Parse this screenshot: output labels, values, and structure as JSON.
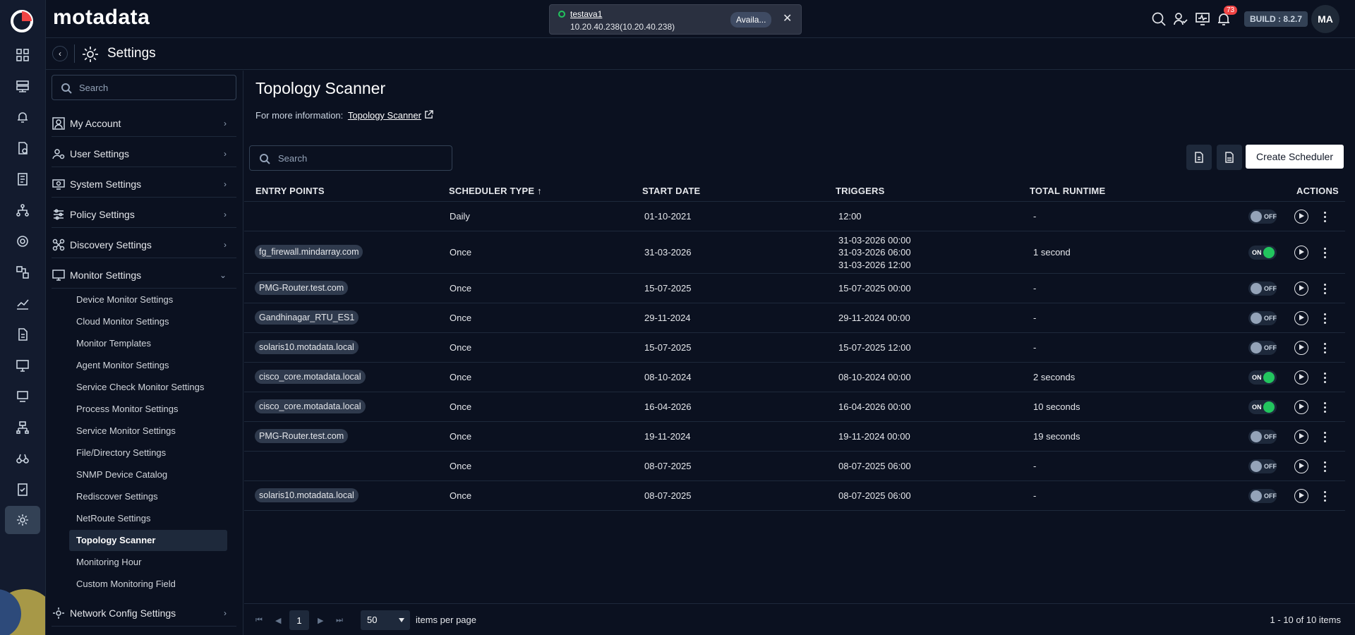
{
  "app": {
    "brand": "motadata",
    "page_title": "Settings"
  },
  "toast": {
    "name": "testava1",
    "address": "10.20.40.238(10.20.40.238)",
    "status": "Availa...",
    "close": "✕"
  },
  "header": {
    "notification_count": "73",
    "build": "BUILD : 8.2.7",
    "avatar": "MA"
  },
  "sidebar": {
    "search_placeholder": "Search",
    "sections": [
      {
        "label": "My Account",
        "icon": "user-icon"
      },
      {
        "label": "User Settings",
        "icon": "user-gear-icon"
      },
      {
        "label": "System Settings",
        "icon": "system-icon"
      },
      {
        "label": "Policy Settings",
        "icon": "sliders-icon"
      },
      {
        "label": "Discovery Settings",
        "icon": "discovery-icon"
      },
      {
        "label": "Monitor Settings",
        "icon": "monitor-icon"
      },
      {
        "label": "Network Config Settings",
        "icon": "network-config-icon"
      }
    ],
    "monitor_items": [
      "Device Monitor Settings",
      "Cloud Monitor Settings",
      "Monitor Templates",
      "Agent Monitor Settings",
      "Service Check Monitor Settings",
      "Process Monitor Settings",
      "Service Monitor Settings",
      "File/Directory Settings",
      "SNMP Device Catalog",
      "Rediscover Settings",
      "NetRoute Settings",
      "Topology Scanner",
      "Monitoring Hour",
      "Custom Monitoring Field"
    ],
    "active_item": "Topology Scanner"
  },
  "main": {
    "title": "Topology Scanner",
    "info_prefix": "For more information:",
    "info_link": "Topology Scanner",
    "search_placeholder": "Search",
    "create_button": "Create Scheduler",
    "columns": [
      "ENTRY POINTS",
      "SCHEDULER TYPE ↑",
      "START DATE",
      "TRIGGERS",
      "TOTAL RUNTIME",
      "ACTIONS"
    ],
    "rows": [
      {
        "entry": "",
        "type": "Daily",
        "start": "01-10-2021",
        "triggers": [
          "12:00"
        ],
        "runtime": "-",
        "state": "OFF"
      },
      {
        "entry": "fg_firewall.mindarray.com",
        "type": "Once",
        "start": "31-03-2026",
        "triggers": [
          "31-03-2026 00:00",
          "31-03-2026 06:00",
          "31-03-2026 12:00"
        ],
        "runtime": "1 second",
        "state": "ON"
      },
      {
        "entry": "PMG-Router.test.com",
        "type": "Once",
        "start": "15-07-2025",
        "triggers": [
          "15-07-2025 00:00"
        ],
        "runtime": "-",
        "state": "OFF"
      },
      {
        "entry": "Gandhinagar_RTU_ES1",
        "type": "Once",
        "start": "29-11-2024",
        "triggers": [
          "29-11-2024 00:00"
        ],
        "runtime": "-",
        "state": "OFF"
      },
      {
        "entry": "solaris10.motadata.local",
        "type": "Once",
        "start": "15-07-2025",
        "triggers": [
          "15-07-2025 12:00"
        ],
        "runtime": "-",
        "state": "OFF"
      },
      {
        "entry": "cisco_core.motadata.local",
        "type": "Once",
        "start": "08-10-2024",
        "triggers": [
          "08-10-2024 00:00"
        ],
        "runtime": "2 seconds",
        "state": "ON"
      },
      {
        "entry": "cisco_core.motadata.local",
        "type": "Once",
        "start": "16-04-2026",
        "triggers": [
          "16-04-2026 00:00"
        ],
        "runtime": "10 seconds",
        "state": "ON"
      },
      {
        "entry": "PMG-Router.test.com",
        "type": "Once",
        "start": "19-11-2024",
        "triggers": [
          "19-11-2024 00:00"
        ],
        "runtime": "19 seconds",
        "state": "OFF"
      },
      {
        "entry": "",
        "type": "Once",
        "start": "08-07-2025",
        "triggers": [
          "08-07-2025 06:00"
        ],
        "runtime": "-",
        "state": "OFF"
      },
      {
        "entry": "solaris10.motadata.local",
        "type": "Once",
        "start": "08-07-2025",
        "triggers": [
          "08-07-2025 06:00"
        ],
        "runtime": "-",
        "state": "OFF"
      }
    ],
    "pagination": {
      "page": "1",
      "page_size": "50",
      "per_page_label": "items per page",
      "count_label": "1 - 10 of 10 items"
    }
  },
  "colors": {
    "background": "#0b1120",
    "rail": "#131b2e",
    "on": "#22c55e",
    "badge": "#ef4444",
    "accent": "#ef4444"
  }
}
